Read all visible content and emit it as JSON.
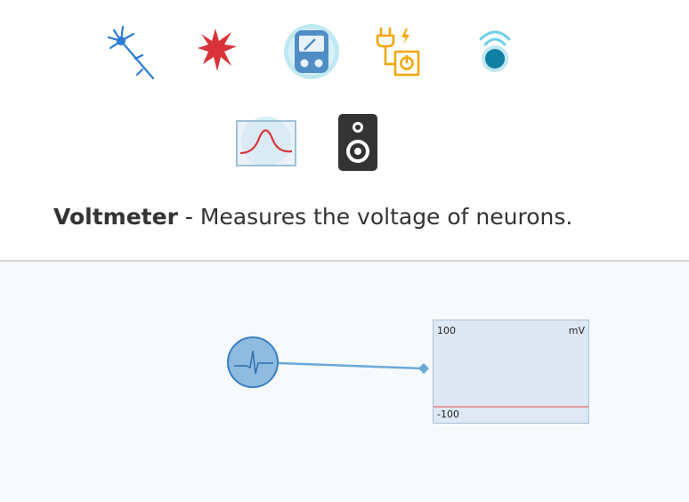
{
  "toolbar": {
    "tools": [
      {
        "name": "neuron",
        "icon": "neuron-icon",
        "color": "#2e7bd6"
      },
      {
        "name": "astrocyte",
        "icon": "astrocyte-icon",
        "color": "#d8333a"
      },
      {
        "name": "voltmeter",
        "icon": "voltmeter-icon",
        "color": "#4a90c8",
        "selected": true
      },
      {
        "name": "current-source",
        "icon": "current-source-icon",
        "color": "#f4a500"
      },
      {
        "name": "sensor",
        "icon": "sensor-icon",
        "color": "#0f7fa3"
      },
      {
        "name": "graph",
        "icon": "graph-icon",
        "color": "#d8333a"
      },
      {
        "name": "speaker",
        "icon": "speaker-icon",
        "color": "#333333"
      }
    ]
  },
  "description": {
    "tool_name": "Voltmeter",
    "text": " - Measures the voltage of neurons."
  },
  "canvas": {
    "meter": {
      "max_label": "100",
      "min_label": "-100",
      "unit_label": "mV"
    }
  }
}
